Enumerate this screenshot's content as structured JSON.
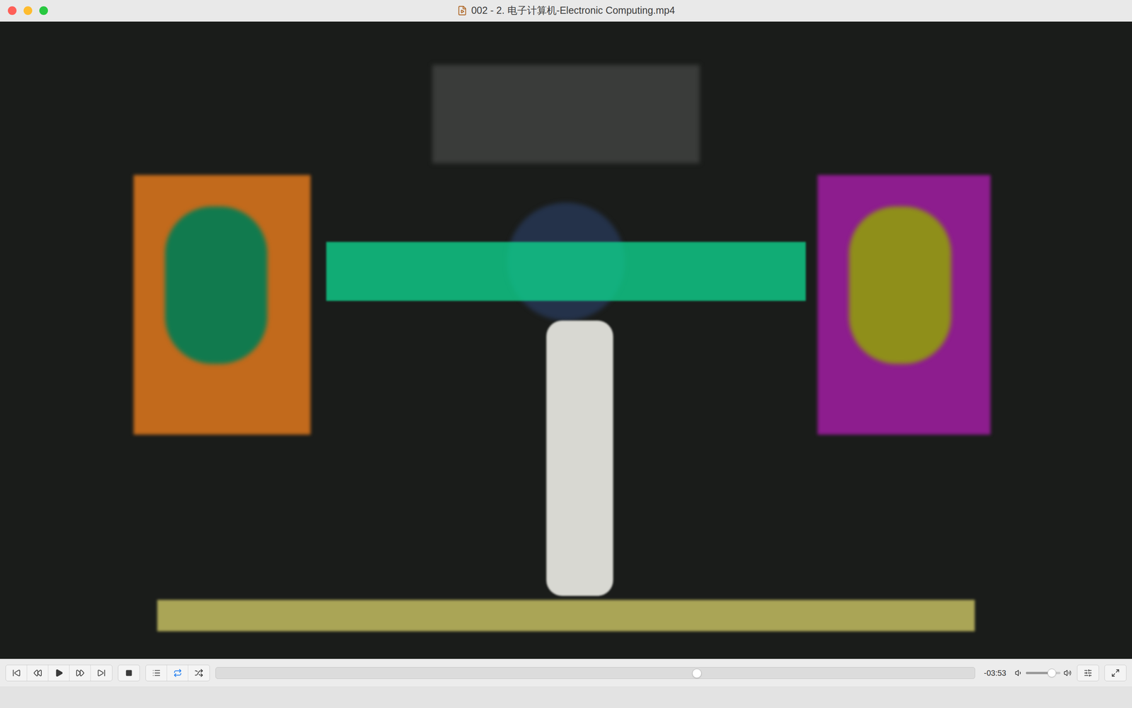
{
  "window": {
    "title": "002 - 2. 电子计算机-Electronic Computing.mp4"
  },
  "player": {
    "playing": false,
    "loop": true,
    "shuffle": false,
    "progress": {
      "level": 0.634,
      "time": "-03:53"
    },
    "volume": {
      "level": 0.75
    }
  }
}
